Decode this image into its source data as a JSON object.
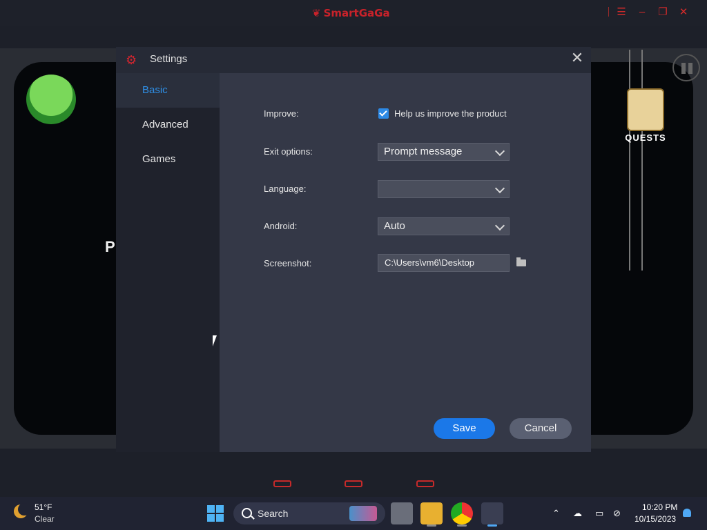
{
  "window": {
    "app_name": "SmartGaGa",
    "controls": [
      "menu-icon",
      "minimize-icon",
      "restore-icon",
      "close-icon"
    ]
  },
  "game": {
    "left_letter": "P",
    "quests_label": "QUESTS"
  },
  "settings": {
    "title": "Settings",
    "sidebar": [
      {
        "label": "Basic",
        "active": true
      },
      {
        "label": "Advanced",
        "active": false
      },
      {
        "label": "Games",
        "active": false
      }
    ],
    "improve": {
      "label": "Improve:",
      "checkbox_text": "Help us improve the product",
      "checked": true
    },
    "exit_options": {
      "label": "Exit options:",
      "value": "Prompt message"
    },
    "language": {
      "label": "Language:",
      "value": ""
    },
    "android": {
      "label": "Android:",
      "value": "Auto"
    },
    "screenshot": {
      "label": "Screenshot:",
      "value": "C:\\Users\\vm6\\Desktop"
    },
    "save_label": "Save",
    "cancel_label": "Cancel"
  },
  "taskbar": {
    "weather": {
      "temp": "51°F",
      "condition": "Clear"
    },
    "search_placeholder": "Search",
    "clock": {
      "time": "10:20 PM",
      "date": "10/15/2023"
    }
  },
  "colors": {
    "accent": "#2f8fe6",
    "save": "#1b78e8",
    "brand_red": "#c8222a"
  }
}
